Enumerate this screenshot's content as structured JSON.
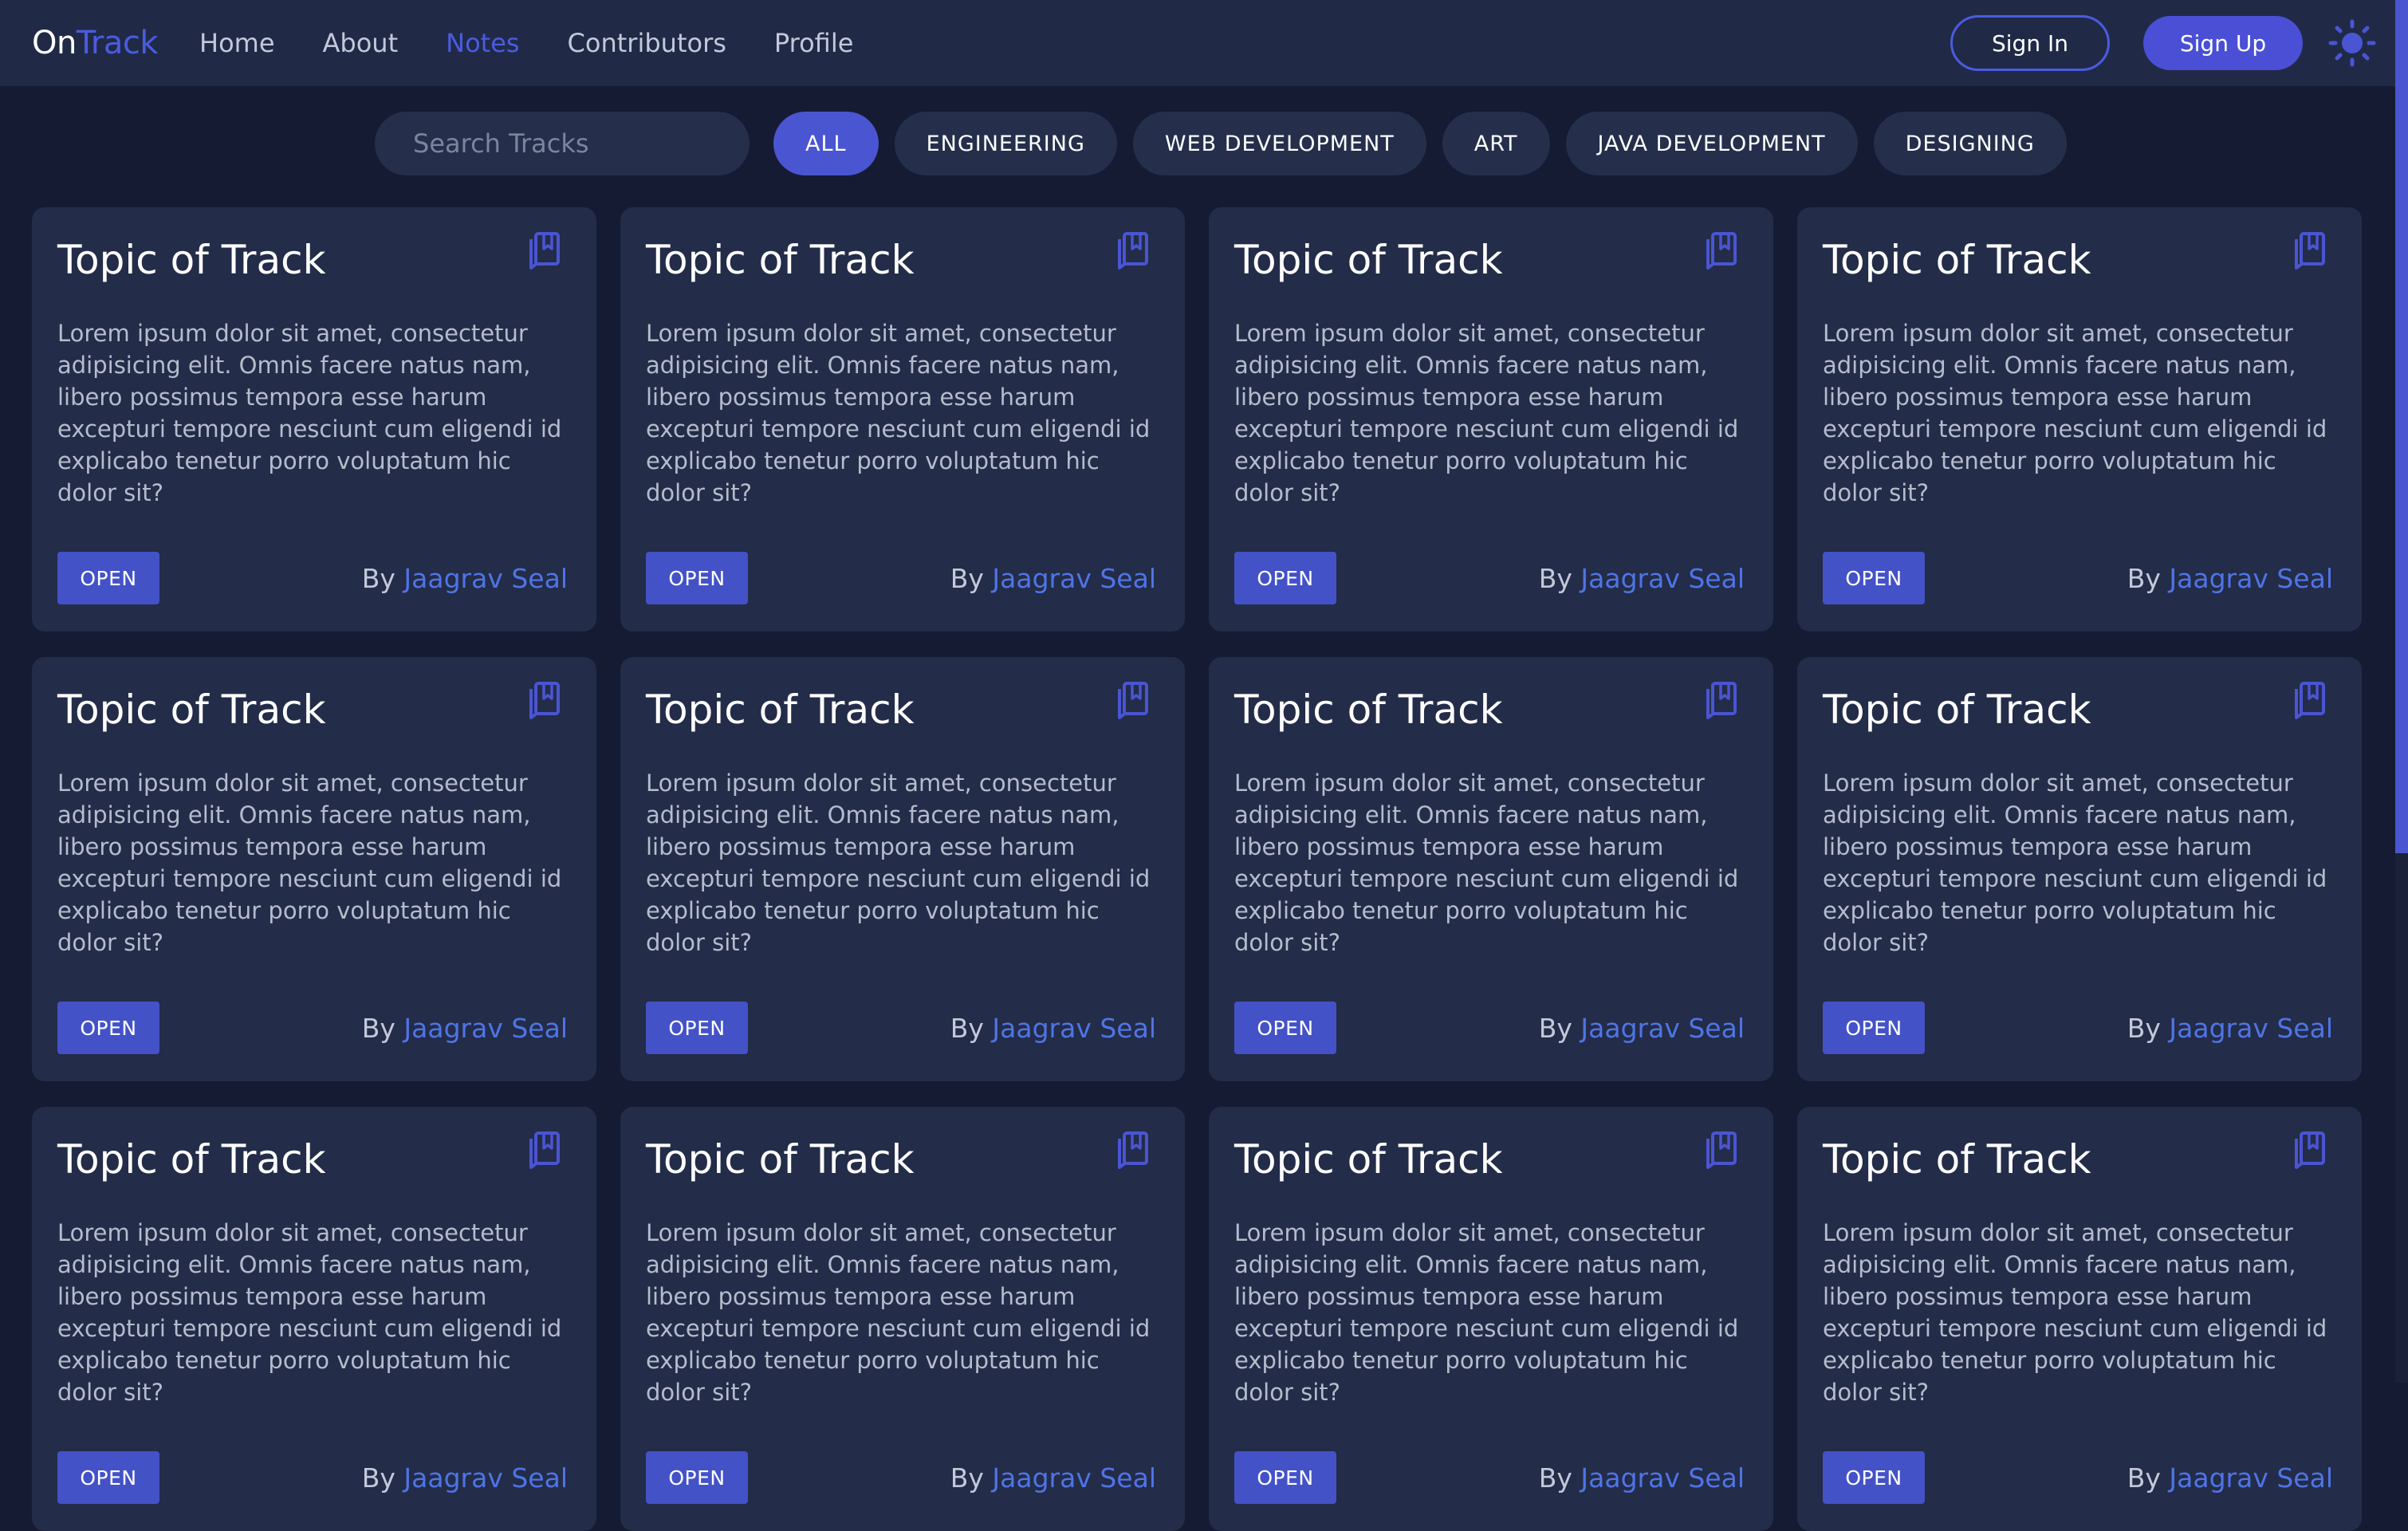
{
  "brand": {
    "part1": "On",
    "part2": "Track"
  },
  "nav": {
    "links": [
      "Home",
      "About",
      "Notes",
      "Contributors",
      "Profile"
    ],
    "active": "Notes",
    "sign_in": "Sign In",
    "sign_up": "Sign Up"
  },
  "search": {
    "placeholder": "Search Tracks",
    "value": ""
  },
  "filters": [
    "ALL",
    "ENGINEERING",
    "WEB DEVELOPMENT",
    "ART",
    "JAVA DEVELOPMENT",
    "DESIGNING"
  ],
  "active_filter": "ALL",
  "cards": [
    {
      "title": "Topic of Track",
      "description": "Lorem ipsum dolor sit amet, consectetur adipisicing elit. Omnis facere natus nam, libero possimus tempora esse harum excepturi tempore nesciunt cum eligendi id explicabo tenetur porro voluptatum hic dolor sit?",
      "open_label": "OPEN",
      "by_label": "By",
      "author": "Jaagrav Seal"
    },
    {
      "title": "Topic of Track",
      "description": "Lorem ipsum dolor sit amet, consectetur adipisicing elit. Omnis facere natus nam, libero possimus tempora esse harum excepturi tempore nesciunt cum eligendi id explicabo tenetur porro voluptatum hic dolor sit?",
      "open_label": "OPEN",
      "by_label": "By",
      "author": "Jaagrav Seal"
    },
    {
      "title": "Topic of Track",
      "description": "Lorem ipsum dolor sit amet, consectetur adipisicing elit. Omnis facere natus nam, libero possimus tempora esse harum excepturi tempore nesciunt cum eligendi id explicabo tenetur porro voluptatum hic dolor sit?",
      "open_label": "OPEN",
      "by_label": "By",
      "author": "Jaagrav Seal"
    },
    {
      "title": "Topic of Track",
      "description": "Lorem ipsum dolor sit amet, consectetur adipisicing elit. Omnis facere natus nam, libero possimus tempora esse harum excepturi tempore nesciunt cum eligendi id explicabo tenetur porro voluptatum hic dolor sit?",
      "open_label": "OPEN",
      "by_label": "By",
      "author": "Jaagrav Seal"
    },
    {
      "title": "Topic of Track",
      "description": "Lorem ipsum dolor sit amet, consectetur adipisicing elit. Omnis facere natus nam, libero possimus tempora esse harum excepturi tempore nesciunt cum eligendi id explicabo tenetur porro voluptatum hic dolor sit?",
      "open_label": "OPEN",
      "by_label": "By",
      "author": "Jaagrav Seal"
    },
    {
      "title": "Topic of Track",
      "description": "Lorem ipsum dolor sit amet, consectetur adipisicing elit. Omnis facere natus nam, libero possimus tempora esse harum excepturi tempore nesciunt cum eligendi id explicabo tenetur porro voluptatum hic dolor sit?",
      "open_label": "OPEN",
      "by_label": "By",
      "author": "Jaagrav Seal"
    },
    {
      "title": "Topic of Track",
      "description": "Lorem ipsum dolor sit amet, consectetur adipisicing elit. Omnis facere natus nam, libero possimus tempora esse harum excepturi tempore nesciunt cum eligendi id explicabo tenetur porro voluptatum hic dolor sit?",
      "open_label": "OPEN",
      "by_label": "By",
      "author": "Jaagrav Seal"
    },
    {
      "title": "Topic of Track",
      "description": "Lorem ipsum dolor sit amet, consectetur adipisicing elit. Omnis facere natus nam, libero possimus tempora esse harum excepturi tempore nesciunt cum eligendi id explicabo tenetur porro voluptatum hic dolor sit?",
      "open_label": "OPEN",
      "by_label": "By",
      "author": "Jaagrav Seal"
    },
    {
      "title": "Topic of Track",
      "description": "Lorem ipsum dolor sit amet, consectetur adipisicing elit. Omnis facere natus nam, libero possimus tempora esse harum excepturi tempore nesciunt cum eligendi id explicabo tenetur porro voluptatum hic dolor sit?",
      "open_label": "OPEN",
      "by_label": "By",
      "author": "Jaagrav Seal"
    },
    {
      "title": "Topic of Track",
      "description": "Lorem ipsum dolor sit amet, consectetur adipisicing elit. Omnis facere natus nam, libero possimus tempora esse harum excepturi tempore nesciunt cum eligendi id explicabo tenetur porro voluptatum hic dolor sit?",
      "open_label": "OPEN",
      "by_label": "By",
      "author": "Jaagrav Seal"
    },
    {
      "title": "Topic of Track",
      "description": "Lorem ipsum dolor sit amet, consectetur adipisicing elit. Omnis facere natus nam, libero possimus tempora esse harum excepturi tempore nesciunt cum eligendi id explicabo tenetur porro voluptatum hic dolor sit?",
      "open_label": "OPEN",
      "by_label": "By",
      "author": "Jaagrav Seal"
    },
    {
      "title": "Topic of Track",
      "description": "Lorem ipsum dolor sit amet, consectetur adipisicing elit. Omnis facere natus nam, libero possimus tempora esse harum excepturi tempore nesciunt cum eligendi id explicabo tenetur porro voluptatum hic dolor sit?",
      "open_label": "OPEN",
      "by_label": "By",
      "author": "Jaagrav Seal"
    }
  ],
  "icons": {
    "search": "search-icon",
    "theme": "sun-icon",
    "bookmark": "bookmark-icon"
  },
  "colors": {
    "background": "#151b33",
    "navbar": "#202a47",
    "card": "#232c48",
    "accent": "#4a55d2",
    "link": "#4f74e6",
    "muted_text": "#b6bccd"
  }
}
